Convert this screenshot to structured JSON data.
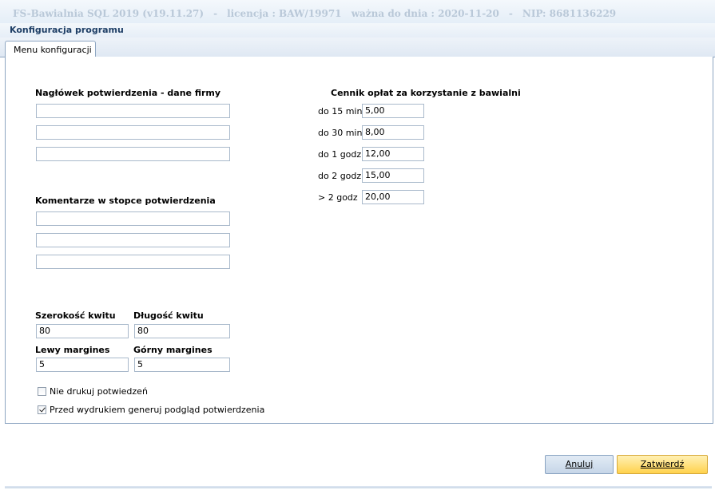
{
  "window": {
    "app_title": "FS-Bawialnia SQL 2019 (v19.11.27)",
    "license": "licencja : BAW/19971",
    "valid_until": "ważna do dnia : 2020-11-20",
    "nip": "NIP: 8681136229",
    "separator": "-"
  },
  "dialog": {
    "title": "Konfiguracja programu"
  },
  "tabs": [
    {
      "label": "Menu konfiguracji"
    }
  ],
  "header_section": {
    "title": "Nagłówek potwierdzenia - dane firmy",
    "lines": [
      "",
      "",
      ""
    ]
  },
  "footer_section": {
    "title": "Komentarze w stopce potwierdzenia",
    "lines": [
      "",
      "",
      ""
    ]
  },
  "receipt": {
    "width_label": "Szerokość kwitu",
    "width_value": "80",
    "length_label": "Długość kwitu",
    "length_value": "80",
    "left_margin_label": "Lewy margines",
    "left_margin_value": "5",
    "top_margin_label": "Górny margines",
    "top_margin_value": "5"
  },
  "options": [
    {
      "label": "Nie drukuj potwiedzeń",
      "checked": false
    },
    {
      "label": "Przed wydrukiem generuj podgląd potwierdzenia",
      "checked": true
    }
  ],
  "pricing": {
    "title": "Cennik opłat za korzystanie z bawialni",
    "rows": [
      {
        "label": "do 15 min",
        "value": "5,00"
      },
      {
        "label": "do 30 min",
        "value": "8,00"
      },
      {
        "label": "do 1 godz",
        "value": "12,00"
      },
      {
        "label": "do 2 godz",
        "value": "15,00"
      },
      {
        "label": "> 2 godz",
        "value": "20,00"
      }
    ]
  },
  "buttons": {
    "cancel": {
      "label": "Anuluj"
    },
    "ok": {
      "label": "Zatwierdź"
    }
  }
}
